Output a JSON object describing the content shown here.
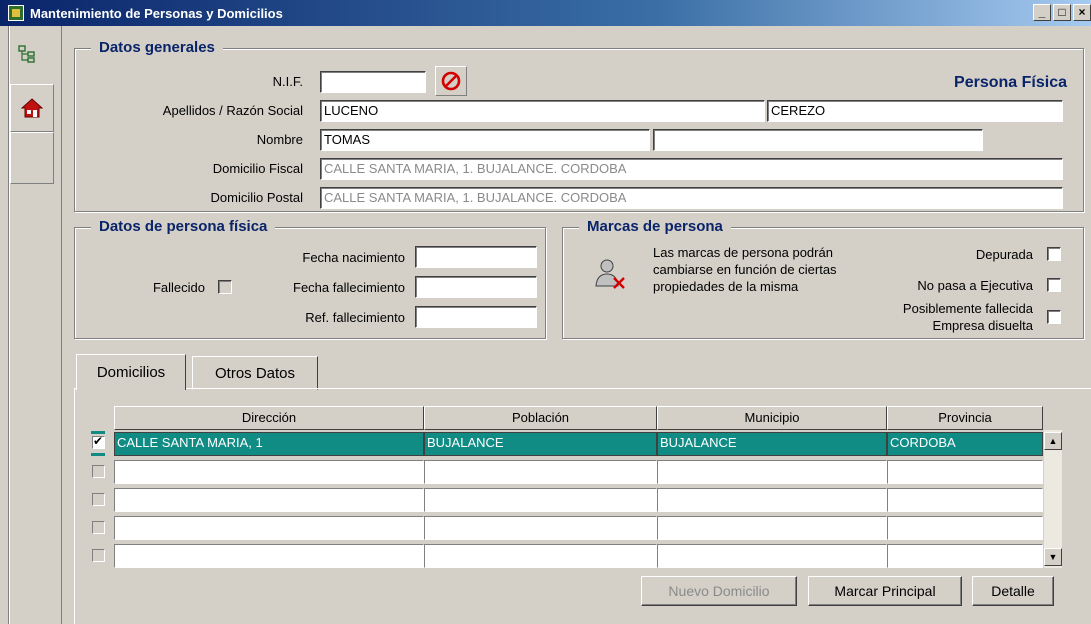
{
  "window": {
    "title": "Mantenimiento de Personas y Domicilios",
    "min_label": "_",
    "max_label": "□",
    "close_label": "×"
  },
  "datos_generales": {
    "title": "Datos generales",
    "nif_label": "N.I.F.",
    "nif_value": "",
    "apellidos_label": "Apellidos / Razón Social",
    "apellido1": "LUCENO",
    "apellido2": "CEREZO",
    "nombre_label": "Nombre",
    "nombre": "TOMAS",
    "nombre2": "",
    "dom_fiscal_label": "Domicilio Fiscal",
    "dom_fiscal": "CALLE SANTA MARIA, 1. BUJALANCE. CORDOBA",
    "dom_postal_label": "Domicilio Postal",
    "dom_postal": "CALLE SANTA MARIA, 1. BUJALANCE. CORDOBA",
    "tipo_persona": "Persona Física"
  },
  "persona_fisica": {
    "title": "Datos de persona física",
    "fallecido_label": "Fallecido",
    "fecha_nac_label": "Fecha nacimiento",
    "fecha_nac": "",
    "fecha_fall_label": "Fecha fallecimiento",
    "fecha_fall": "",
    "ref_fall_label": "Ref. fallecimiento",
    "ref_fall": ""
  },
  "marcas": {
    "title": "Marcas de persona",
    "desc": "Las marcas de persona podrán cambiarse en función de ciertas propiedades de la misma",
    "depurada_label": "Depurada",
    "no_pasa_label": "No pasa a Ejecutiva",
    "pos_fallecida_label": "Posiblemente fallecida",
    "empresa_disuelta_label": "Empresa disuelta"
  },
  "tabs": [
    {
      "label": "Domicilios"
    },
    {
      "label": "Otros Datos"
    }
  ],
  "grid": {
    "headers": [
      "Dirección",
      "Población",
      "Municipio",
      "Provincia"
    ],
    "rows": [
      {
        "checked": true,
        "cells": [
          "CALLE SANTA MARIA, 1",
          "BUJALANCE",
          "BUJALANCE",
          "CORDOBA"
        ]
      },
      {
        "checked": false,
        "cells": [
          "",
          "",
          "",
          ""
        ]
      },
      {
        "checked": false,
        "cells": [
          "",
          "",
          "",
          ""
        ]
      },
      {
        "checked": false,
        "cells": [
          "",
          "",
          "",
          ""
        ]
      },
      {
        "checked": false,
        "cells": [
          "",
          "",
          "",
          ""
        ]
      }
    ]
  },
  "buttons": {
    "nuevo": "Nuevo Domicilio",
    "marcar": "Marcar Principal",
    "detalle": "Detalle"
  },
  "colors": {
    "title_blue": "#0a246a",
    "selection_teal": "#108c84",
    "no_icon_red": "#d40000"
  }
}
